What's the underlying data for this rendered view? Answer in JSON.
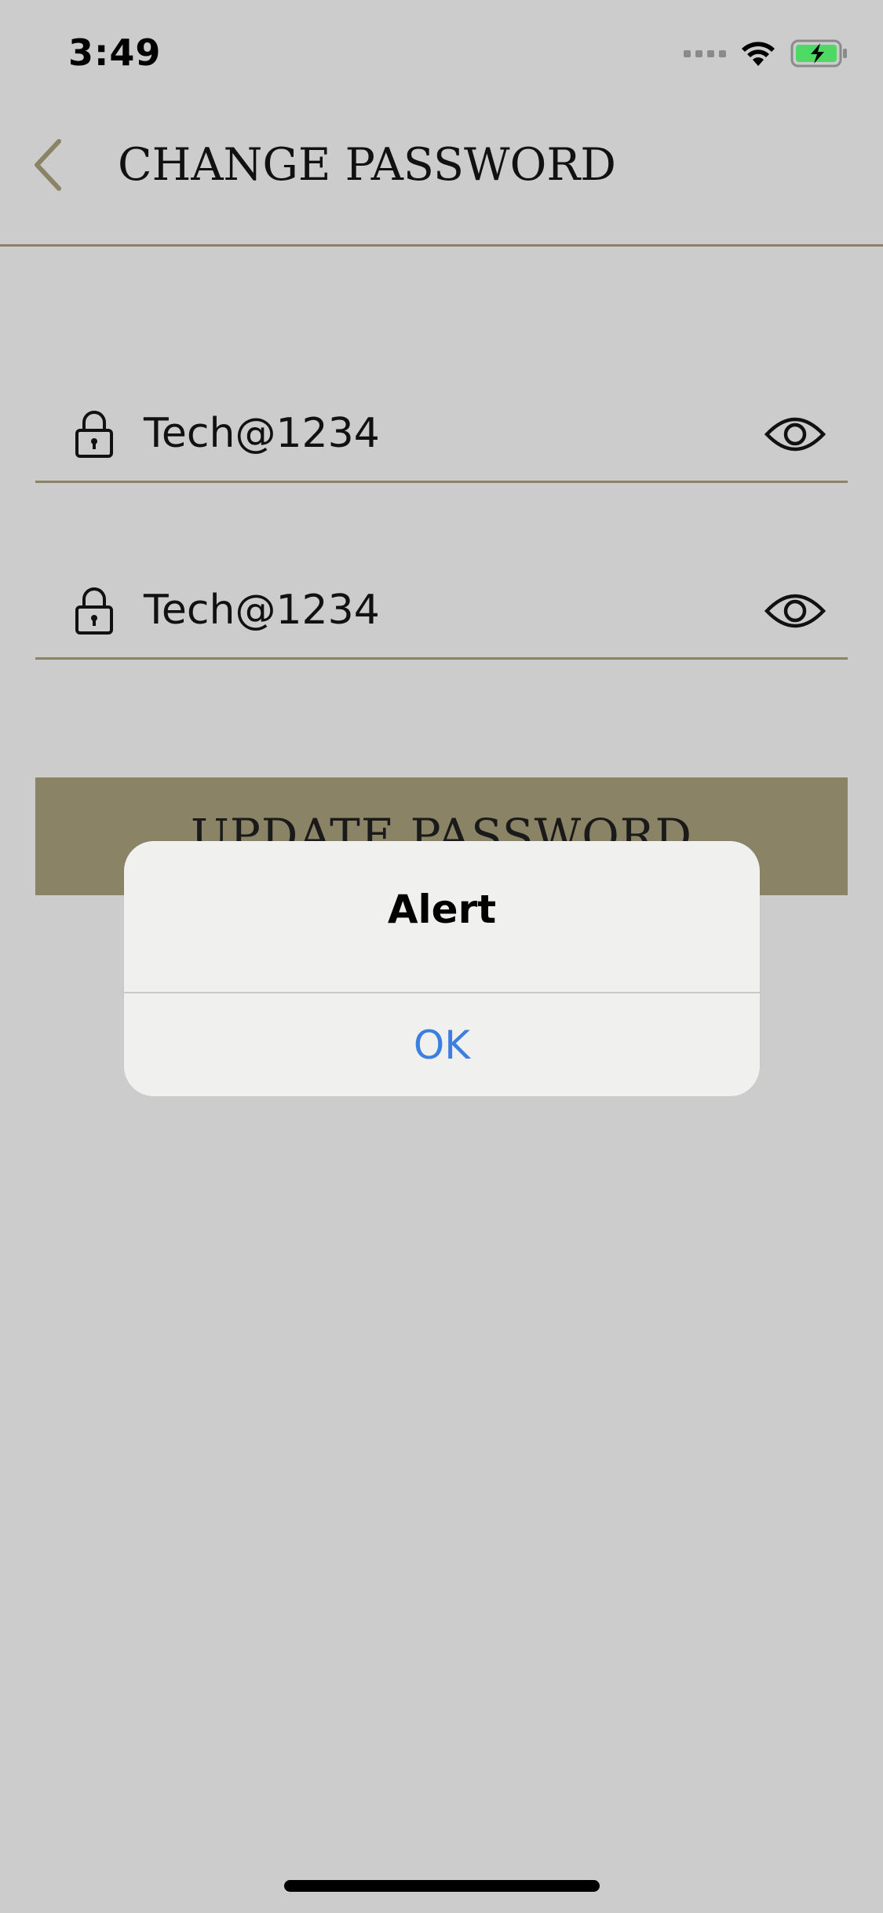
{
  "status_bar": {
    "time": "3:49",
    "icons": [
      "cellular-signal-icon",
      "wifi-icon",
      "battery-charging-icon"
    ]
  },
  "header": {
    "back_icon": "chevron-left-icon",
    "title": "CHANGE PASSWORD"
  },
  "form": {
    "fields": [
      {
        "icon": "lock-icon",
        "value": "Tech@1234",
        "toggle_icon": "eye-icon"
      },
      {
        "icon": "lock-icon",
        "value": "Tech@1234",
        "toggle_icon": "eye-icon"
      }
    ],
    "submit_label": "UPDATE PASSWORD"
  },
  "alert": {
    "title": "Alert",
    "ok_label": "OK"
  },
  "colors": {
    "background": "#cccccc",
    "accent": "#8a8366",
    "alert_button": "#3b7fe0",
    "battery": "#4cd964"
  }
}
